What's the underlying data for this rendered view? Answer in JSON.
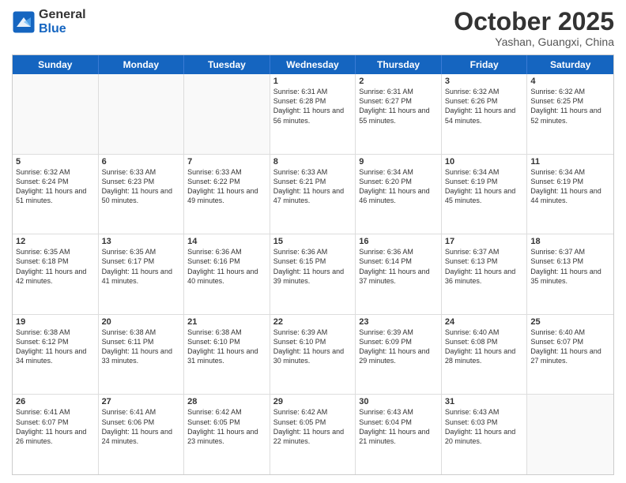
{
  "header": {
    "logo": {
      "general": "General",
      "blue": "Blue"
    },
    "title": "October 2025",
    "location": "Yashan, Guangxi, China"
  },
  "days": [
    "Sunday",
    "Monday",
    "Tuesday",
    "Wednesday",
    "Thursday",
    "Friday",
    "Saturday"
  ],
  "weeks": [
    [
      {
        "day": "",
        "empty": true
      },
      {
        "day": "",
        "empty": true
      },
      {
        "day": "",
        "empty": true
      },
      {
        "day": "1",
        "sunrise": "6:31 AM",
        "sunset": "6:28 PM",
        "daylight": "11 hours and 56 minutes."
      },
      {
        "day": "2",
        "sunrise": "6:31 AM",
        "sunset": "6:27 PM",
        "daylight": "11 hours and 55 minutes."
      },
      {
        "day": "3",
        "sunrise": "6:32 AM",
        "sunset": "6:26 PM",
        "daylight": "11 hours and 54 minutes."
      },
      {
        "day": "4",
        "sunrise": "6:32 AM",
        "sunset": "6:25 PM",
        "daylight": "11 hours and 52 minutes."
      }
    ],
    [
      {
        "day": "5",
        "sunrise": "6:32 AM",
        "sunset": "6:24 PM",
        "daylight": "11 hours and 51 minutes."
      },
      {
        "day": "6",
        "sunrise": "6:33 AM",
        "sunset": "6:23 PM",
        "daylight": "11 hours and 50 minutes."
      },
      {
        "day": "7",
        "sunrise": "6:33 AM",
        "sunset": "6:22 PM",
        "daylight": "11 hours and 49 minutes."
      },
      {
        "day": "8",
        "sunrise": "6:33 AM",
        "sunset": "6:21 PM",
        "daylight": "11 hours and 47 minutes."
      },
      {
        "day": "9",
        "sunrise": "6:34 AM",
        "sunset": "6:20 PM",
        "daylight": "11 hours and 46 minutes."
      },
      {
        "day": "10",
        "sunrise": "6:34 AM",
        "sunset": "6:19 PM",
        "daylight": "11 hours and 45 minutes."
      },
      {
        "day": "11",
        "sunrise": "6:34 AM",
        "sunset": "6:19 PM",
        "daylight": "11 hours and 44 minutes."
      }
    ],
    [
      {
        "day": "12",
        "sunrise": "6:35 AM",
        "sunset": "6:18 PM",
        "daylight": "11 hours and 42 minutes."
      },
      {
        "day": "13",
        "sunrise": "6:35 AM",
        "sunset": "6:17 PM",
        "daylight": "11 hours and 41 minutes."
      },
      {
        "day": "14",
        "sunrise": "6:36 AM",
        "sunset": "6:16 PM",
        "daylight": "11 hours and 40 minutes."
      },
      {
        "day": "15",
        "sunrise": "6:36 AM",
        "sunset": "6:15 PM",
        "daylight": "11 hours and 39 minutes."
      },
      {
        "day": "16",
        "sunrise": "6:36 AM",
        "sunset": "6:14 PM",
        "daylight": "11 hours and 37 minutes."
      },
      {
        "day": "17",
        "sunrise": "6:37 AM",
        "sunset": "6:13 PM",
        "daylight": "11 hours and 36 minutes."
      },
      {
        "day": "18",
        "sunrise": "6:37 AM",
        "sunset": "6:13 PM",
        "daylight": "11 hours and 35 minutes."
      }
    ],
    [
      {
        "day": "19",
        "sunrise": "6:38 AM",
        "sunset": "6:12 PM",
        "daylight": "11 hours and 34 minutes."
      },
      {
        "day": "20",
        "sunrise": "6:38 AM",
        "sunset": "6:11 PM",
        "daylight": "11 hours and 33 minutes."
      },
      {
        "day": "21",
        "sunrise": "6:38 AM",
        "sunset": "6:10 PM",
        "daylight": "11 hours and 31 minutes."
      },
      {
        "day": "22",
        "sunrise": "6:39 AM",
        "sunset": "6:10 PM",
        "daylight": "11 hours and 30 minutes."
      },
      {
        "day": "23",
        "sunrise": "6:39 AM",
        "sunset": "6:09 PM",
        "daylight": "11 hours and 29 minutes."
      },
      {
        "day": "24",
        "sunrise": "6:40 AM",
        "sunset": "6:08 PM",
        "daylight": "11 hours and 28 minutes."
      },
      {
        "day": "25",
        "sunrise": "6:40 AM",
        "sunset": "6:07 PM",
        "daylight": "11 hours and 27 minutes."
      }
    ],
    [
      {
        "day": "26",
        "sunrise": "6:41 AM",
        "sunset": "6:07 PM",
        "daylight": "11 hours and 26 minutes."
      },
      {
        "day": "27",
        "sunrise": "6:41 AM",
        "sunset": "6:06 PM",
        "daylight": "11 hours and 24 minutes."
      },
      {
        "day": "28",
        "sunrise": "6:42 AM",
        "sunset": "6:05 PM",
        "daylight": "11 hours and 23 minutes."
      },
      {
        "day": "29",
        "sunrise": "6:42 AM",
        "sunset": "6:05 PM",
        "daylight": "11 hours and 22 minutes."
      },
      {
        "day": "30",
        "sunrise": "6:43 AM",
        "sunset": "6:04 PM",
        "daylight": "11 hours and 21 minutes."
      },
      {
        "day": "31",
        "sunrise": "6:43 AM",
        "sunset": "6:03 PM",
        "daylight": "11 hours and 20 minutes."
      },
      {
        "day": "",
        "empty": true
      }
    ]
  ]
}
